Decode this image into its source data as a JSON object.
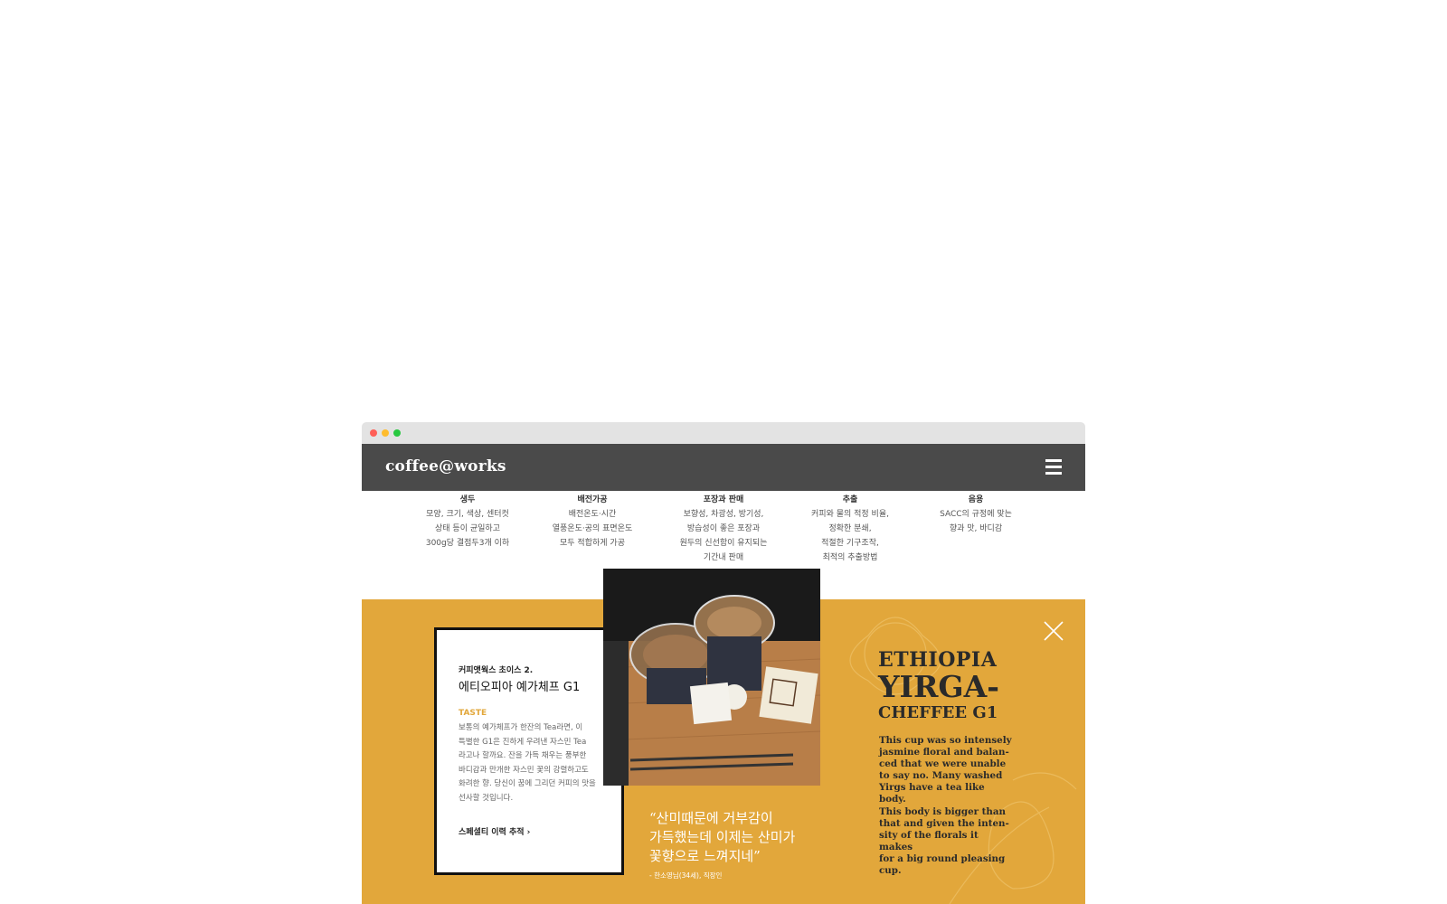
{
  "window": {
    "controls": [
      "close-dot",
      "minimize-dot",
      "maximize-dot"
    ]
  },
  "nav": {
    "logo": "coffee@works",
    "menu_icon": "hamburger-menu-icon"
  },
  "steps": [
    {
      "title": "생두",
      "lines": "모양, 크기, 색상, 센터컷\n상태 등이 균일하고\n300g당 결점두3개 이하"
    },
    {
      "title": "배전가공",
      "lines": "배전온도·시간\n열풍온도·공의 표면온도\n모두 적합하게 가공"
    },
    {
      "title": "포장과 판매",
      "lines": "보향성, 차광성, 방기성,\n방습성이 좋은 포장과\n원두의 신선함이 유지되는\n기간내 판매"
    },
    {
      "title": "추출",
      "lines": "커피와 물의 적정 비율,\n정확한 분쇄,\n적절한 기구조작,\n최적의 추출방법"
    },
    {
      "title": "음용",
      "lines": "SACC의 규정에 맞는\n향과 맛, 바디감"
    }
  ],
  "card": {
    "subtitle": "커피앳웍스 초이스 2.",
    "name": "에티오피아 예가체프 G1",
    "taste_label": "TASTE",
    "description": "보통의 예가체프가 한잔의 Tea라면, 이\n특별한 G1은 진하게 우려낸 자스민 Tea\n라고나 할까요. 잔을 가득 채우는 풍부한\n바디감과 만개한 자스민 꽃의 강렬하고도\n화려한 향. 당신이 꿈에 그리던 커피의 맛을\n선사할 것입니다.",
    "link": "스페셜티 이력 추적"
  },
  "quote": {
    "text": "“산미때문에 거부감이\n가득했는데 이제는 산미가\n꽃향으로 느껴지네”",
    "author": "- 한소영님(34세), 직장인"
  },
  "feature": {
    "title_line1": "ETHIOPIA",
    "title_line2": "YIRGA-",
    "title_line3": "CHEFFEE G1",
    "body": "This cup was so intensely\njasmine floral and balan-\nced that we were unable\nto say no. Many washed\nYirgs have a tea like body.\nThis body is bigger than\nthat and given the inten-\nsity of the florals it makes\nfor a big round pleasing\ncup."
  },
  "colors": {
    "accent": "#e2a73b",
    "nav": "#4a4a4a"
  }
}
